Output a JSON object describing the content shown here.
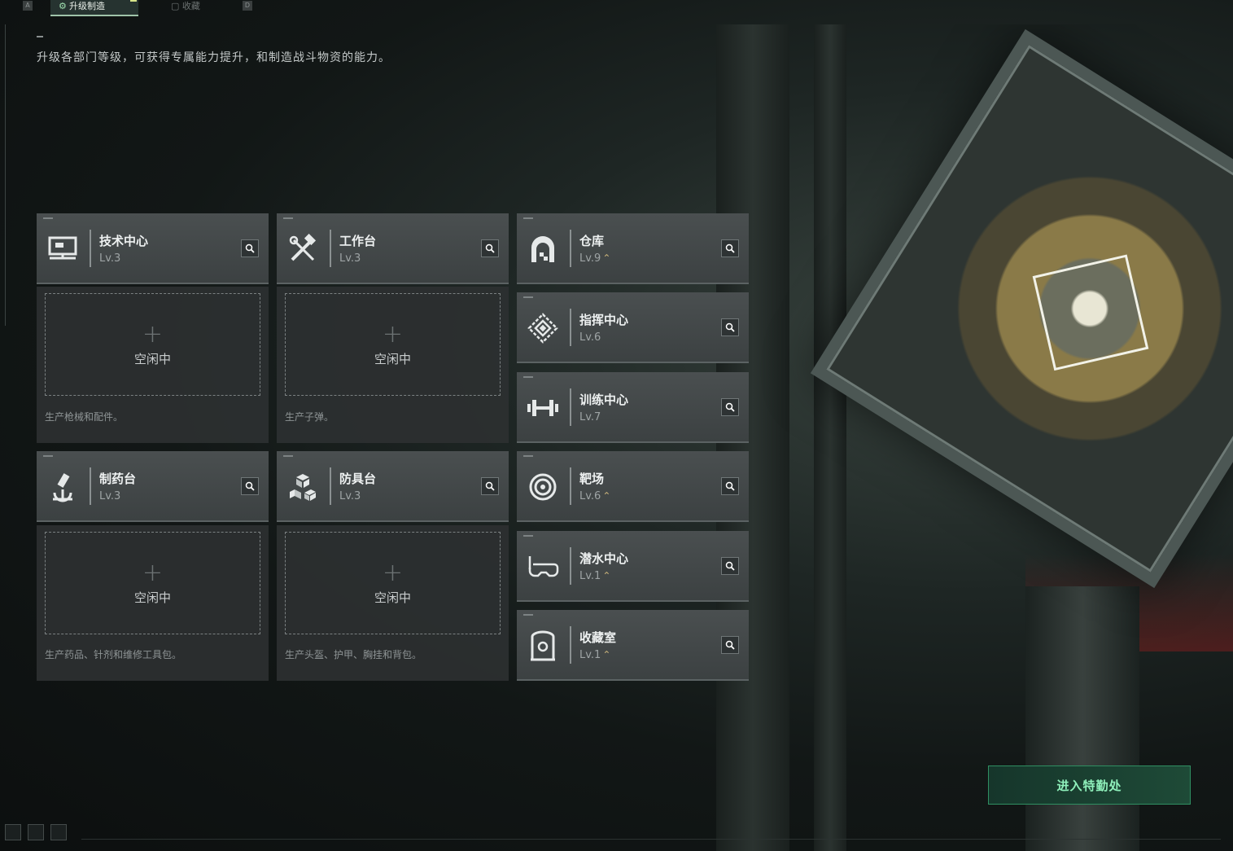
{
  "topbar": {
    "key_left": "A",
    "key_right": "D",
    "tabs": [
      {
        "label": "升级制造",
        "active": true
      },
      {
        "label": "收藏",
        "active": false
      }
    ]
  },
  "subtitle": "升级各部门等级，可获得专属能力提升，和制造战斗物资的能力。",
  "departments": {
    "tech_center": {
      "name": "技术中心",
      "level": "Lv.3"
    },
    "workbench": {
      "name": "工作台",
      "level": "Lv.3",
      "idle": "空闲中",
      "desc": "生产子弹。"
    },
    "tech_idle": {
      "idle": "空闲中",
      "desc": "生产枪械和配件。"
    },
    "pharmacy": {
      "name": "制药台",
      "level": "Lv.3",
      "idle": "空闲中",
      "desc": "生产药品、针剂和维修工具包。"
    },
    "armor": {
      "name": "防具台",
      "level": "Lv.3",
      "idle": "空闲中",
      "desc": "生产头盔、护甲、胸挂和背包。"
    },
    "warehouse": {
      "name": "仓库",
      "level": "Lv.9",
      "upgradable": true
    },
    "command": {
      "name": "指挥中心",
      "level": "Lv.6",
      "upgradable": false
    },
    "training": {
      "name": "训练中心",
      "level": "Lv.7",
      "upgradable": false
    },
    "range": {
      "name": "靶场",
      "level": "Lv.6",
      "upgradable": true
    },
    "diving": {
      "name": "潜水中心",
      "level": "Lv.1",
      "upgradable": true
    },
    "collection": {
      "name": "收藏室",
      "level": "Lv.1",
      "upgradable": true
    }
  },
  "upgrade_glyph": "⌃",
  "enter_button": "进入特勤处",
  "colors": {
    "accent_green": "#8ff0bb",
    "upgrade_gold": "#c9b37a"
  }
}
